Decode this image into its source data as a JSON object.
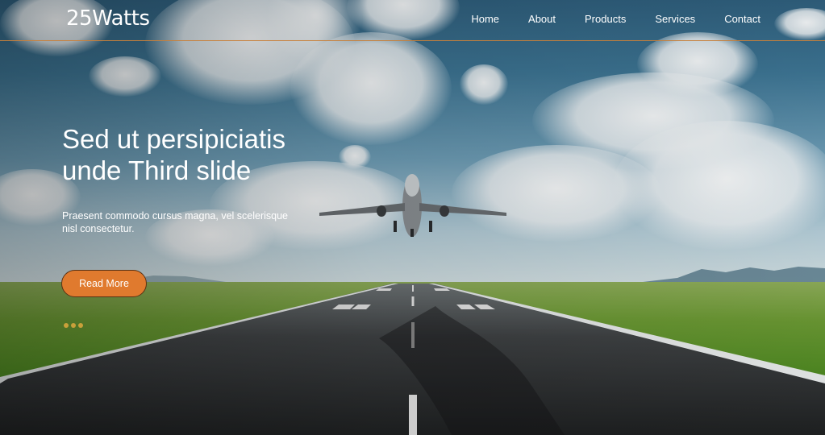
{
  "header": {
    "logo": "25Watts",
    "nav": [
      "Home",
      "About",
      "Products",
      "Services",
      "Contact"
    ]
  },
  "hero": {
    "title_line1": "Sed ut persipiciatis",
    "title_line2": "unde Third slide",
    "description": "Praesent commodo cursus magna, vel scelerisque nisl consectetur.",
    "button": "Read More",
    "slide_count": 3
  },
  "colors": {
    "accent": "#e07a2e",
    "header_border": "#c8803a",
    "indicator": "#c9a03a"
  },
  "icons": [
    "airplane-image",
    "slide-indicator-dot"
  ]
}
